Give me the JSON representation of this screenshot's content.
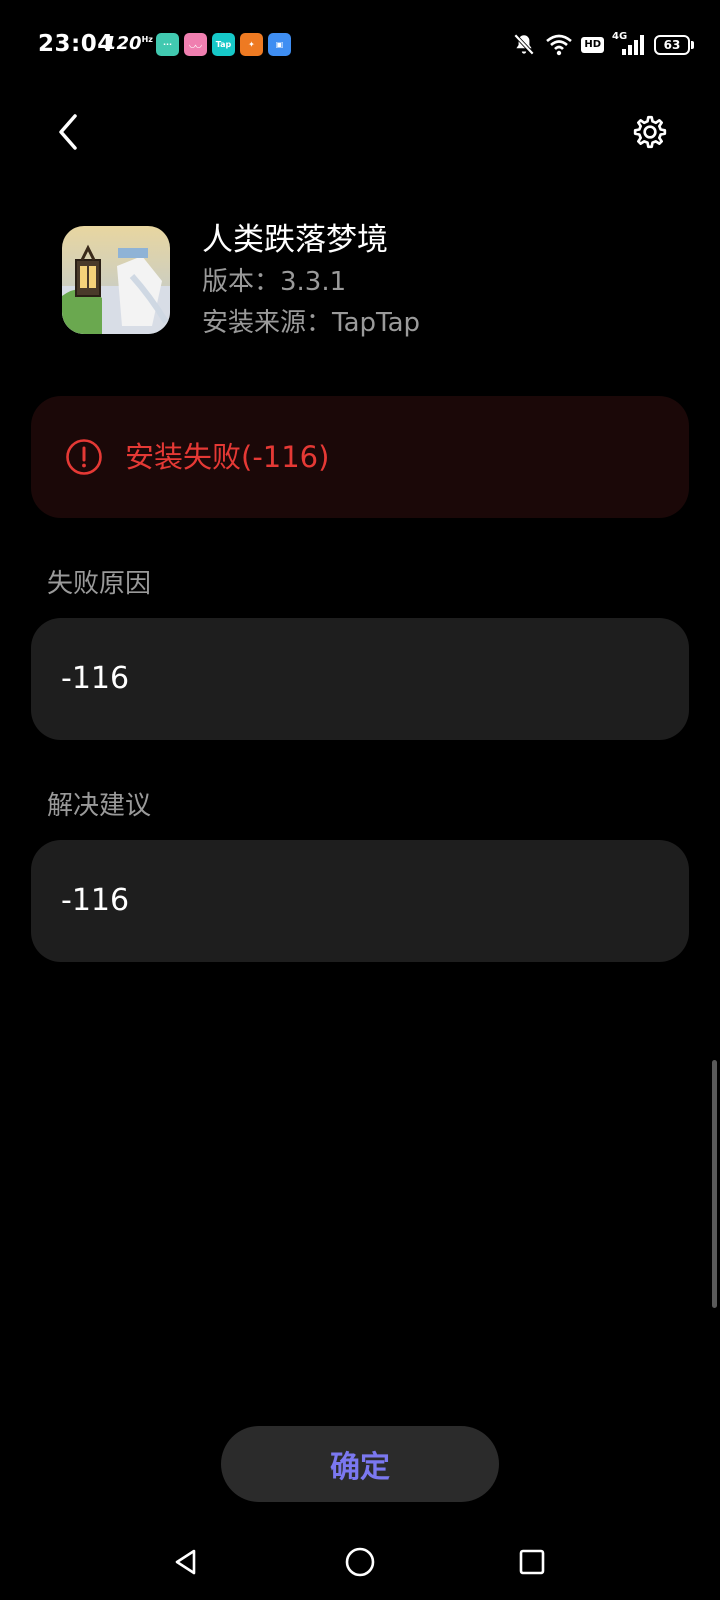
{
  "status_bar": {
    "time": "23:04",
    "refresh_rate": "120",
    "refresh_unit": "Hz",
    "notification_icons": [
      {
        "name": "message-app-icon",
        "color": "#41c9b0",
        "label": "···"
      },
      {
        "name": "reader-app-icon",
        "color": "#f07fb0",
        "label": "◡◡"
      },
      {
        "name": "taptap-app-icon",
        "color": "#16c8c8",
        "label": "Tap"
      },
      {
        "name": "orange-app-icon",
        "color": "#ee7a22",
        "label": "✦"
      },
      {
        "name": "blue-app-icon",
        "color": "#3f8ef2",
        "label": "▣"
      }
    ],
    "hd_label": "HD",
    "network_label": "4G",
    "battery": "63",
    "icons": [
      "mute-bell-icon",
      "wifi-icon",
      "cellular-signal-icon",
      "battery-icon"
    ]
  },
  "header": {
    "back_icon": "chevron-left-icon",
    "settings_icon": "gear-icon"
  },
  "app": {
    "name": "人类跌落梦境",
    "version_text": "版本：3.3.1",
    "source_text": "安装来源：TapTap"
  },
  "error": {
    "icon": "exclamation-circle-icon",
    "message": "安装失败(-116)",
    "color": "#e53935"
  },
  "failure_reason": {
    "label": "失败原因",
    "value": "-116"
  },
  "solution": {
    "label": "解决建议",
    "value": "-116"
  },
  "confirm_button": {
    "label": "确定",
    "color": "#7b78f0"
  },
  "nav_bar": {
    "icons": [
      "nav-back-triangle-icon",
      "nav-home-circle-icon",
      "nav-recent-square-icon"
    ]
  }
}
